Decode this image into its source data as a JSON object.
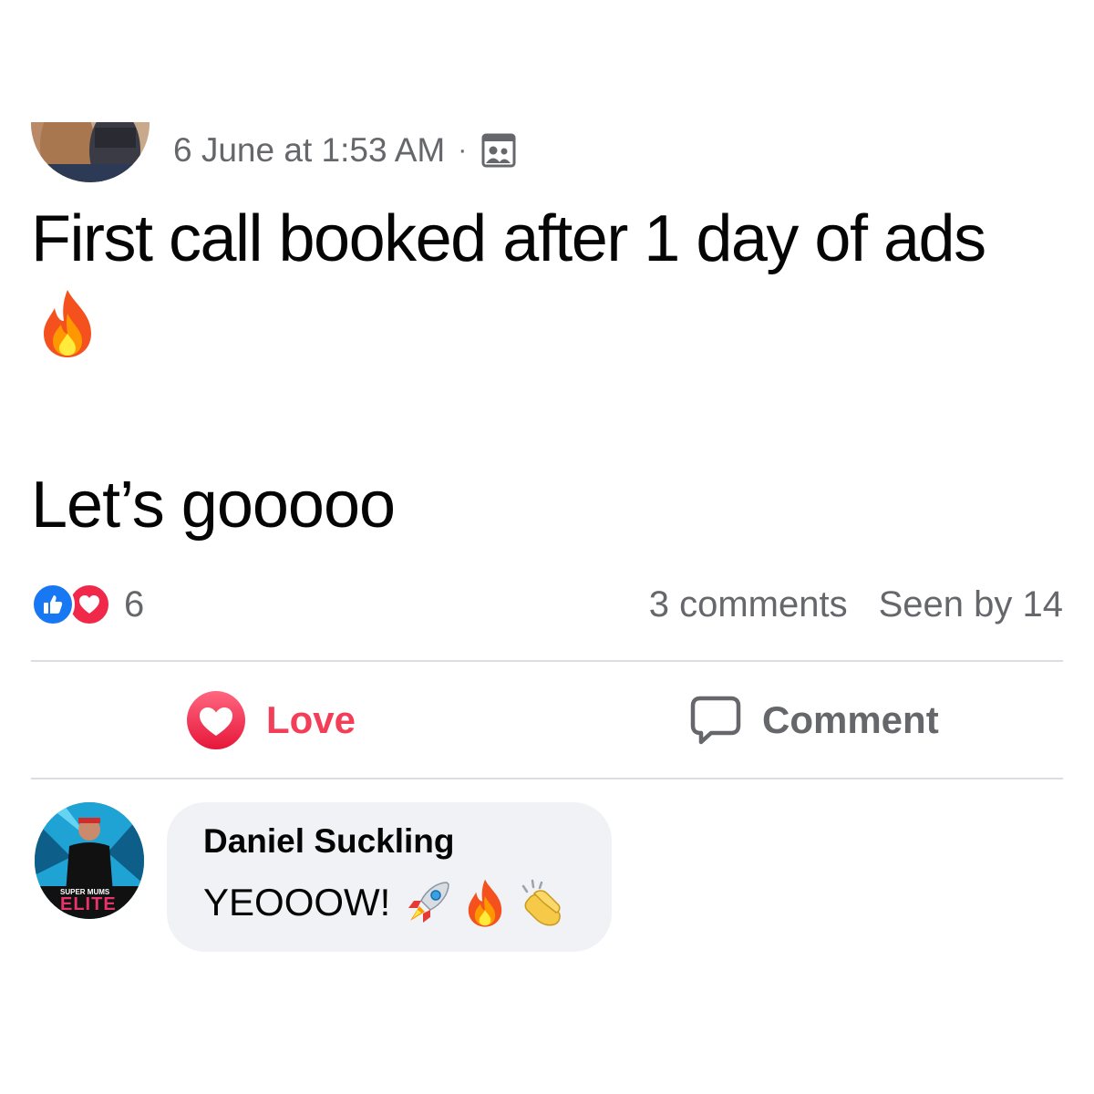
{
  "post": {
    "timestamp": "6 June at 1:53 AM",
    "separator": "·",
    "audience_icon": "group-members-icon",
    "text_line1": "First call booked after 1 day of ads",
    "text_emoji": "fire-icon",
    "text_line2": "Let’s gooooo"
  },
  "stats": {
    "reactions": [
      "like-icon",
      "love-icon"
    ],
    "reaction_count": "6",
    "comments": "3 comments",
    "seen_by": "Seen by 14"
  },
  "actions": {
    "love_label": "Love",
    "comment_label": "Comment",
    "love_color": "#f33e58"
  },
  "comments": [
    {
      "author": "Daniel Suckling",
      "text": "YEOOOW!",
      "emojis": [
        "rocket-icon",
        "fire-icon",
        "clapping-hands-icon"
      ],
      "avatar_label_top": "SUPER MUMS",
      "avatar_label_bottom": "ELITE"
    }
  ],
  "colors": {
    "secondary_text": "#65676b",
    "like_blue": "#1877f2",
    "love_red": "#f02849",
    "bubble_bg": "#f0f2f5"
  }
}
